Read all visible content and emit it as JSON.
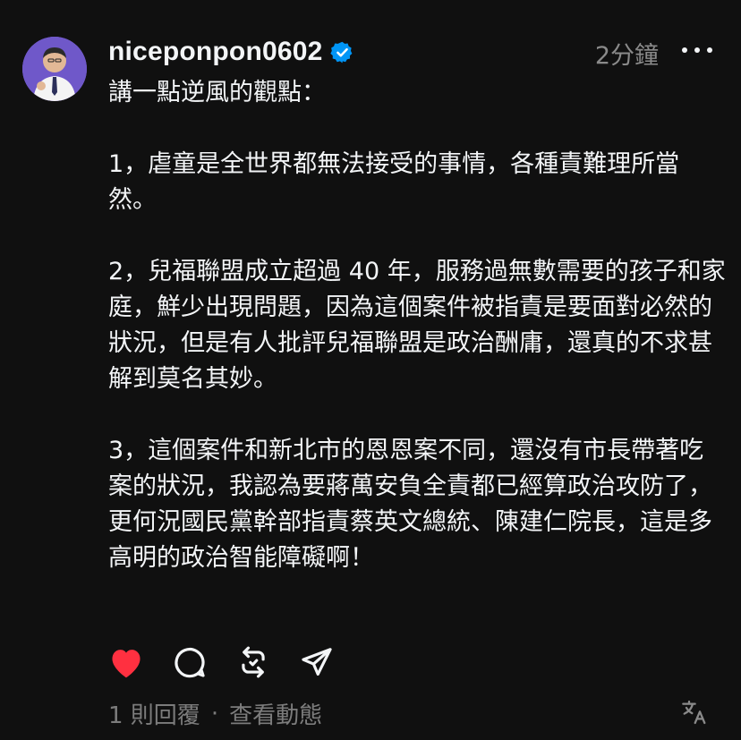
{
  "post": {
    "username": "niceponpon0602",
    "verified": true,
    "time": "2分鐘",
    "paragraphs": [
      "講一點逆風的觀點：",
      "1，虐童是全世界都無法接受的事情，各種責難理所當然。",
      "2，兒福聯盟成立超過 40 年，服務過無數需要的孩子和家庭，鮮少出現問題，因為這個案件被指責是要面對必然的狀況，但是有人批評兒福聯盟是政治酬庸，還真的不求甚解到莫名其妙。",
      "3，這個案件和新北市的恩恩案不同，還沒有市長帶著吃案的狀況，我認為要蔣萬安負全責都已經算政治攻防了，更何況國民黨幹部指責蔡英文總統、陳建仁院長，這是多高明的政治智能障礙啊！"
    ]
  },
  "footer": {
    "replies": "1 則回覆",
    "separator": "·",
    "view_activity": "查看動態"
  },
  "icons": {
    "like": "heart-icon",
    "reply": "comment-icon",
    "repost": "repost-icon",
    "share": "send-icon",
    "translate": "translate-icon",
    "more": "more-icon",
    "verified": "verified-badge-icon"
  },
  "colors": {
    "background": "#101010",
    "text": "#f3f5f7",
    "muted": "#8a8a8a",
    "like": "#ff3040",
    "verified": "#0095f6"
  }
}
